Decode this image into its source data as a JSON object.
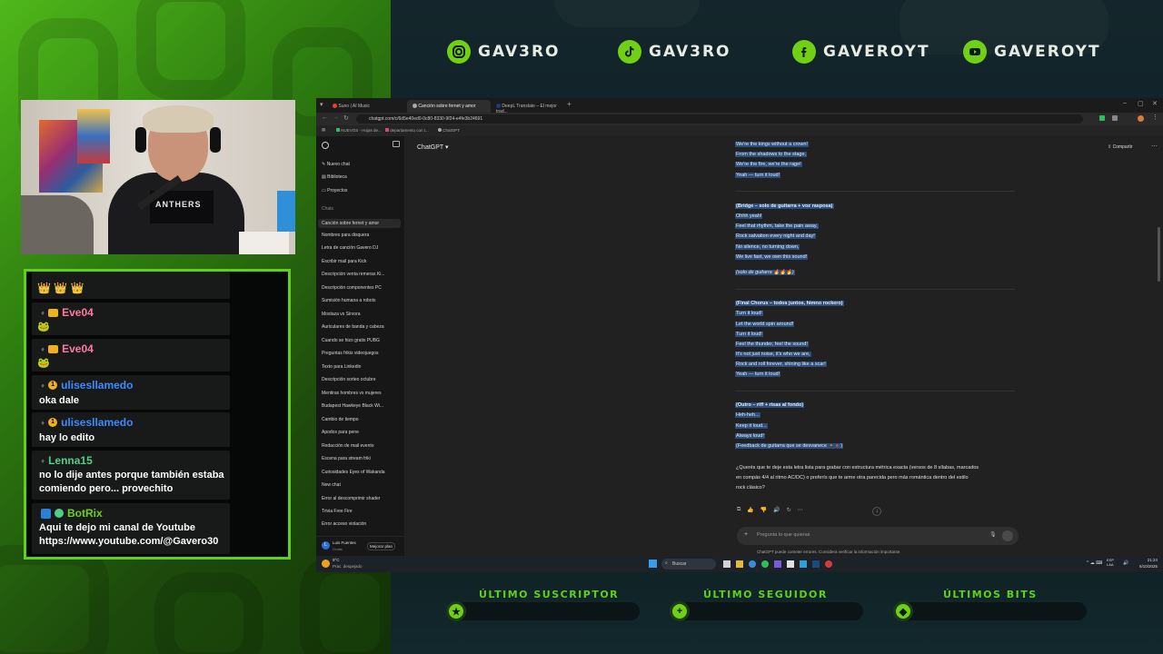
{
  "overlay": {
    "socials": [
      {
        "icon": "instagram-icon",
        "name": "GAV3RO"
      },
      {
        "icon": "tiktok-icon",
        "name": "GAV3RO"
      },
      {
        "icon": "facebook-icon",
        "name": "GAVEROYT"
      },
      {
        "icon": "youtube-icon",
        "name": "GAVEROYT"
      }
    ],
    "bottom": {
      "subscriber_label": "ÚLTIMO SUSCRIPTOR",
      "follower_label": "ÚLTIMO SEGUIDOR",
      "bits_label": "ÚLTIMOS BITS"
    },
    "accent": "#5fd11a"
  },
  "chat": {
    "messages": [
      {
        "user": "Eve04",
        "color": "#ff7aa0",
        "text": ""
      },
      {
        "user": "Eve04",
        "color": "#ff7aa0",
        "text": ""
      },
      {
        "user": "ulisesllamedo",
        "color": "#3a8bff",
        "text": "oka dale"
      },
      {
        "user": "ulisesllamedo",
        "color": "#3a8bff",
        "text": "hay lo edito"
      },
      {
        "user": "Lenna15",
        "color": "#4fd08a",
        "text": "no lo dije antes porque también estaba comiendo pero... provechito"
      },
      {
        "user": "BotRix",
        "color": "#6fd016",
        "text": "Aqui te dejo mi canal de Youtube https://www.youtube.com/@Gavero30"
      }
    ]
  },
  "browser": {
    "tabs": [
      {
        "label": "Suno | AI Music"
      },
      {
        "label": "Canción sobre fernet y amor"
      },
      {
        "label": "DeepL Translate – El mejor trad..."
      }
    ],
    "url": "chatgpt.com/c/6d5e40ed0-0c80-8330-9f24-e4fe3b24691",
    "bookmarks": [
      "NUEVOS - Hojas de...",
      "departamento con t...",
      "ChatGPT"
    ]
  },
  "chatgpt": {
    "model": "ChatGPT",
    "share": "Compartir",
    "sidebar_top": [
      {
        "icon": "edit-icon",
        "label": "Nuevo chat"
      },
      {
        "icon": "library-icon",
        "label": "Biblioteca"
      },
      {
        "icon": "folder-icon",
        "label": "Proyectos"
      }
    ],
    "chats_heading": "Chats",
    "chats": [
      "Canción sobre fernet y amor",
      "Nombres para disquera",
      "Letra de canción Gavero DJ",
      "Escribir mail para Kick",
      "Descripción venta remeras Ki...",
      "Descripción componentes PC",
      "Sumisión humana a robots",
      "Mostaza vs Sirvora",
      "Auriculares de banda y cabeza",
      "Cuando se hizo gratis PUBG",
      "Preguntas frikis videojuegos",
      "Texto para Linkedin",
      "Descripción sorteo octubre",
      "Mentiras hombres vs mujeres",
      "Budapest Hawkeye Black Wi...",
      "Cambio de tiempo",
      "Apodos para pene",
      "Redacción de mail evento",
      "Escena para stream friki",
      "Curiosidades Eyes of Wakanda",
      "New chat",
      "Error al descomprimir shader",
      "Trivia Free Fire",
      "Error acceso violación"
    ],
    "user_name": "Luis Fuentes",
    "user_plan": "Gratis",
    "upgrade": "Mejorar plan",
    "lyrics": [
      "We're the kings without a crown!",
      "From the shadows to the stage,",
      "We're the fire, we're the rage!",
      "Yeah — turn it loud!",
      "(Bridge – solo de guitarra + voz rasposa)",
      "Ohhh yeah!",
      "Feel that rhythm, take the pain away,",
      "Rock salvation every night and day!",
      "No silence, no turning down,",
      "We live fast, we own this sound!",
      "(solo de guitarra 🔥🔥🔥)",
      "(Final Chorus – todos juntos, himno rockero)",
      "Turn it loud!",
      "Let the world spin around!",
      "Turn it loud!",
      "Feel the thunder, feel the sound!",
      "It's not just noise, it's who we are,",
      "Rock and roll forever, shining like a scar!",
      "Yeah — turn it loud!",
      "(Outro – riff + risas al fondo)",
      "Heh-heh...",
      "Keep it loud...",
      "Always loud!",
      "(Feedback de guitarra que se desvanece 🔸🔺)"
    ],
    "question_line1": "¿Querés que te deje esta letra lista para grabar con estructura métrica exacta (versos de 8 sílabas, marcados",
    "question_line2": "en compás 4/4 al ritmo AC/DC) o preferís que te arme otra parecida pero más romántica dentro del estilo",
    "question_line3": "rock clásico?",
    "input_placeholder": "Pregunta lo que quieras",
    "disclaimer": "ChatGPT puede cometer errores. Considera verificar la información importante."
  },
  "taskbar": {
    "weather_temp": "9°C",
    "weather_desc": "Prac. despejado",
    "search": "Buscar",
    "lang": "ESP LAA",
    "time": "21:24",
    "date": "6/10/2025"
  }
}
